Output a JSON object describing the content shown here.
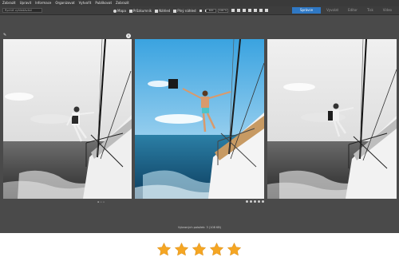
{
  "menu": [
    "Zobrazit",
    "Upravit",
    "Informace",
    "Organizovat",
    "Vytvořit",
    "Publikovat",
    "Zobrazit"
  ],
  "search": {
    "placeholder": "Rychlé vyhledávání"
  },
  "toolbar": {
    "items": [
      {
        "label": "Mapa",
        "icon": "map-pin-icon"
      },
      {
        "label": "Průzkumník",
        "icon": "folder-icon"
      },
      {
        "label": "Náhled",
        "icon": "image-icon"
      },
      {
        "label": "Plný náhled",
        "icon": "monitor-icon"
      }
    ],
    "dimension": "400",
    "zoom": "100 %"
  },
  "modes": [
    {
      "label": "Správce",
      "active": true
    },
    {
      "label": "Vyvolat",
      "active": false
    },
    {
      "label": "Editor",
      "active": false
    },
    {
      "label": "Tisk",
      "active": false
    },
    {
      "label": "Video",
      "active": false
    }
  ],
  "status": {
    "text": "Vybraných položek: 3 (108 KB)"
  },
  "rating": {
    "stars": 5,
    "max": 5,
    "color": "#f5a623"
  },
  "colors": {
    "accent": "#2f78c4",
    "background": "#4a4a4a",
    "menubar": "#3a3a3a"
  }
}
